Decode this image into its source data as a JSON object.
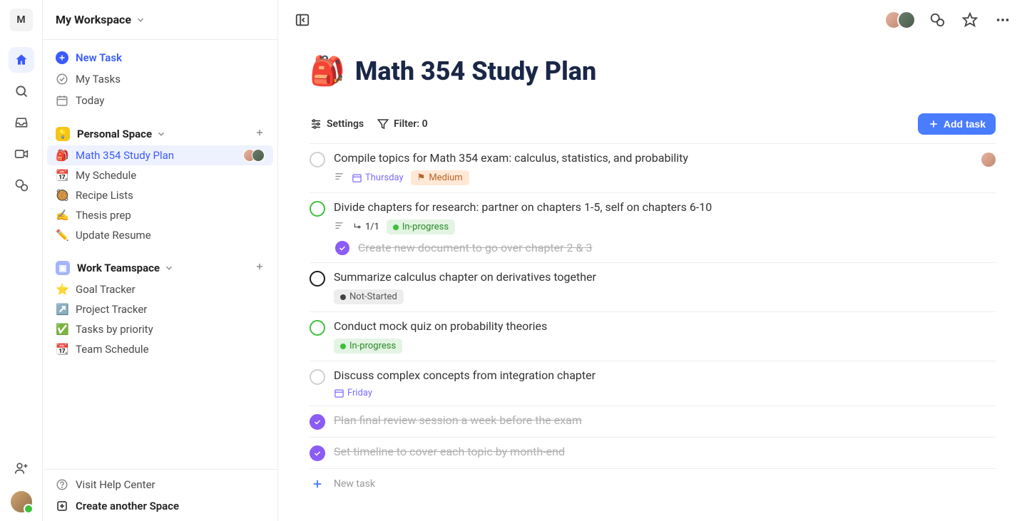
{
  "app_initial": "M",
  "workspace_name": "My Workspace",
  "rail": {
    "icons": [
      "home",
      "search",
      "inbox",
      "video",
      "chat",
      "add-user"
    ]
  },
  "sidebar": {
    "quick": [
      {
        "icon": "plus-circle",
        "label": "New Task"
      },
      {
        "icon": "check-circle",
        "label": "My Tasks"
      },
      {
        "icon": "calendar",
        "label": "Today"
      }
    ],
    "sections": [
      {
        "name": "Personal Space",
        "badge_color": "yellow",
        "pages": [
          {
            "emoji": "🎒",
            "label": "Math 354 Study Plan",
            "active": true,
            "shared": true
          },
          {
            "emoji": "📆",
            "label": "My Schedule"
          },
          {
            "emoji": "🥘",
            "label": "Recipe Lists"
          },
          {
            "emoji": "✍️",
            "label": "Thesis prep"
          },
          {
            "emoji": "✏️",
            "label": "Update Resume"
          }
        ]
      },
      {
        "name": "Work Teamspace",
        "badge_color": "indigo",
        "pages": [
          {
            "emoji": "⭐",
            "label": "Goal Tracker"
          },
          {
            "emoji": "↗️",
            "label": "Project Tracker"
          },
          {
            "emoji": "✅",
            "label": "Tasks by priority"
          },
          {
            "emoji": "📆",
            "label": "Team Schedule"
          }
        ]
      }
    ],
    "footer": [
      {
        "icon": "help",
        "label": "Visit Help Center"
      },
      {
        "icon": "plus-square",
        "label": "Create another Space",
        "bold": true
      }
    ]
  },
  "page": {
    "emoji": "🎒",
    "title": "Math 354 Study Plan",
    "toolbar": {
      "settings_label": "Settings",
      "filter_label": "Filter: 0",
      "add_task_label": "Add task"
    }
  },
  "tasks": [
    {
      "title": "Compile topics for Math 354 exam: calculus, statistics, and probability",
      "check_style": "light",
      "due": "Thursday",
      "priority": "Medium",
      "has_description": true,
      "assignee": true
    },
    {
      "title": "Divide chapters for research: partner on chapters 1-5, self on chapters 6-10",
      "check_style": "green",
      "has_description": true,
      "subtask_count": "1/1",
      "status": "In-progress",
      "subtasks": [
        {
          "title": "Create new document to go over chapter 2 & 3",
          "done": true
        }
      ]
    },
    {
      "title": "Summarize calculus chapter on derivatives together",
      "check_style": "dark",
      "status": "Not-Started"
    },
    {
      "title": "Conduct mock quiz on probability theories",
      "check_style": "green",
      "status": "In-progress"
    },
    {
      "title": "Discuss complex concepts from integration chapter",
      "check_style": "light",
      "due": "Friday"
    },
    {
      "title": "Plan final review session a week before the exam",
      "check_style": "done"
    },
    {
      "title": "Set timeline to cover each topic by month-end",
      "check_style": "done"
    }
  ],
  "new_task_placeholder": "New task"
}
